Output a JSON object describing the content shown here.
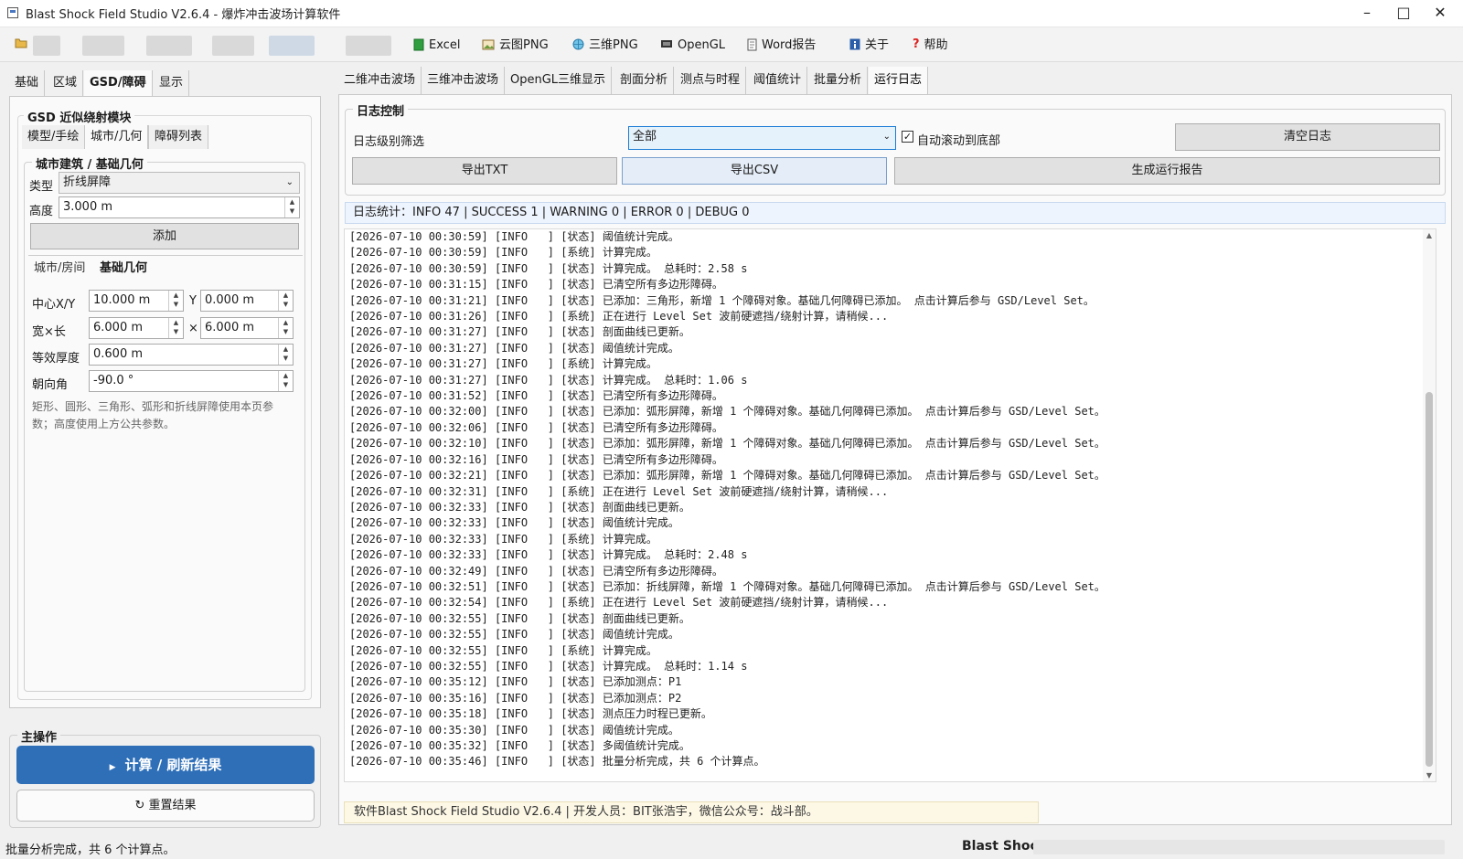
{
  "window": {
    "title": "Blast Shock Field Studio V2.6.4 - 爆炸冲击波场计算软件"
  },
  "toolbar": {
    "excel": "Excel",
    "cloud_png": "云图PNG",
    "three_d_png": "三维PNG",
    "opengl": "OpenGL",
    "word_report": "Word报告",
    "about": "关于",
    "help": "帮助"
  },
  "left": {
    "tabs": [
      "基础",
      "区域",
      "GSD/障碍",
      "显示"
    ],
    "gsd_title": "GSD 近似绕射模块",
    "subtabs": [
      "模型/手绘",
      "城市/几何",
      "障碍列表"
    ],
    "city_title": "城市建筑 / 基础几何",
    "type_label": "类型",
    "type_value": "折线屏障",
    "height_label": "高度",
    "height_value": "3.000 m",
    "add_button": "添加",
    "subtabs2": [
      "城市/房间",
      "基础几何"
    ],
    "center_label": "中心X/Y",
    "center_x": "10.000 m",
    "y_label": "Y",
    "center_y": "0.000 m",
    "wh_label": "宽×长",
    "width_value": "6.000 m",
    "x_label": "×",
    "length_value": "6.000 m",
    "thick_label": "等效厚度",
    "thick_value": "0.600 m",
    "orient_label": "朝向角",
    "orient_value": "-90.0 °",
    "hint": "矩形、圆形、三角形、弧形和折线屏障使用本页参数；高度使用上方公共参数。",
    "main_ops_title": "主操作",
    "compute_button": "计算 / 刷新结果",
    "reset_button": "重置结果"
  },
  "right": {
    "tabs": [
      "二维冲击波场",
      "三维冲击波场",
      "OpenGL三维显示",
      "剖面分析",
      "测点与时程",
      "阈值统计",
      "批量分析",
      "运行日志"
    ],
    "log_control_title": "日志控制",
    "level_label": "日志级别筛选",
    "level_value": "全部",
    "autoscroll_label": "自动滚动到底部",
    "clear_button": "清空日志",
    "export_txt": "导出TXT",
    "export_csv": "导出CSV",
    "gen_report": "生成运行报告",
    "stats": "日志统计：INFO 47 | SUCCESS 1 | WARNING 0 | ERROR 0 | DEBUG 0",
    "log_lines": [
      "[2026-07-10 00:30:59] [INFO   ] [状态] 阈值统计完成。",
      "[2026-07-10 00:30:59] [INFO   ] [系统] 计算完成。",
      "[2026-07-10 00:30:59] [INFO   ] [状态] 计算完成。 总耗时：2.58 s",
      "[2026-07-10 00:31:15] [INFO   ] [状态] 已清空所有多边形障碍。",
      "[2026-07-10 00:31:21] [INFO   ] [状态] 已添加：三角形，新增 1 个障碍对象。基础几何障碍已添加。 点击计算后参与 GSD/Level Set。",
      "[2026-07-10 00:31:26] [INFO   ] [系统] 正在进行 Level Set 波前硬遮挡/绕射计算，请稍候...",
      "[2026-07-10 00:31:27] [INFO   ] [状态] 剖面曲线已更新。",
      "[2026-07-10 00:31:27] [INFO   ] [状态] 阈值统计完成。",
      "[2026-07-10 00:31:27] [INFO   ] [系统] 计算完成。",
      "[2026-07-10 00:31:27] [INFO   ] [状态] 计算完成。 总耗时：1.06 s",
      "[2026-07-10 00:31:52] [INFO   ] [状态] 已清空所有多边形障碍。",
      "[2026-07-10 00:32:00] [INFO   ] [状态] 已添加：弧形屏障，新增 1 个障碍对象。基础几何障碍已添加。 点击计算后参与 GSD/Level Set。",
      "[2026-07-10 00:32:06] [INFO   ] [状态] 已清空所有多边形障碍。",
      "[2026-07-10 00:32:10] [INFO   ] [状态] 已添加：弧形屏障，新增 1 个障碍对象。基础几何障碍已添加。 点击计算后参与 GSD/Level Set。",
      "[2026-07-10 00:32:16] [INFO   ] [状态] 已清空所有多边形障碍。",
      "[2026-07-10 00:32:21] [INFO   ] [状态] 已添加：弧形屏障，新增 1 个障碍对象。基础几何障碍已添加。 点击计算后参与 GSD/Level Set。",
      "[2026-07-10 00:32:31] [INFO   ] [系统] 正在进行 Level Set 波前硬遮挡/绕射计算，请稍候...",
      "[2026-07-10 00:32:33] [INFO   ] [状态] 剖面曲线已更新。",
      "[2026-07-10 00:32:33] [INFO   ] [状态] 阈值统计完成。",
      "[2026-07-10 00:32:33] [INFO   ] [系统] 计算完成。",
      "[2026-07-10 00:32:33] [INFO   ] [状态] 计算完成。 总耗时：2.48 s",
      "[2026-07-10 00:32:49] [INFO   ] [状态] 已清空所有多边形障碍。",
      "[2026-07-10 00:32:51] [INFO   ] [状态] 已添加：折线屏障，新增 1 个障碍对象。基础几何障碍已添加。 点击计算后参与 GSD/Level Set。",
      "[2026-07-10 00:32:54] [INFO   ] [系统] 正在进行 Level Set 波前硬遮挡/绕射计算，请稍候...",
      "[2026-07-10 00:32:55] [INFO   ] [状态] 剖面曲线已更新。",
      "[2026-07-10 00:32:55] [INFO   ] [状态] 阈值统计完成。",
      "[2026-07-10 00:32:55] [INFO   ] [系统] 计算完成。",
      "[2026-07-10 00:32:55] [INFO   ] [状态] 计算完成。 总耗时：1.14 s",
      "[2026-07-10 00:35:12] [INFO   ] [状态] 已添加测点：P1",
      "[2026-07-10 00:35:16] [INFO   ] [状态] 已添加测点：P2",
      "[2026-07-10 00:35:18] [INFO   ] [状态] 测点压力时程已更新。",
      "[2026-07-10 00:35:30] [INFO   ] [状态] 阈值统计完成。",
      "[2026-07-10 00:35:32] [INFO   ] [状态] 多阈值统计完成。",
      "[2026-07-10 00:35:46] [INFO   ] [状态] 批量分析完成，共 6 个计算点。"
    ],
    "footer_info": "软件Blast Shock Field Studio V2.6.4 | 开发人员：BIT张浩宇，微信公众号：战斗部。"
  },
  "status": {
    "left": "批量分析完成，共 6 个计算点。",
    "right": "Blast Shock"
  },
  "colors": {
    "accent": "#2e6fb8",
    "log_info_bg": "#fdf8e6",
    "stats_bg": "#eef4fd"
  }
}
